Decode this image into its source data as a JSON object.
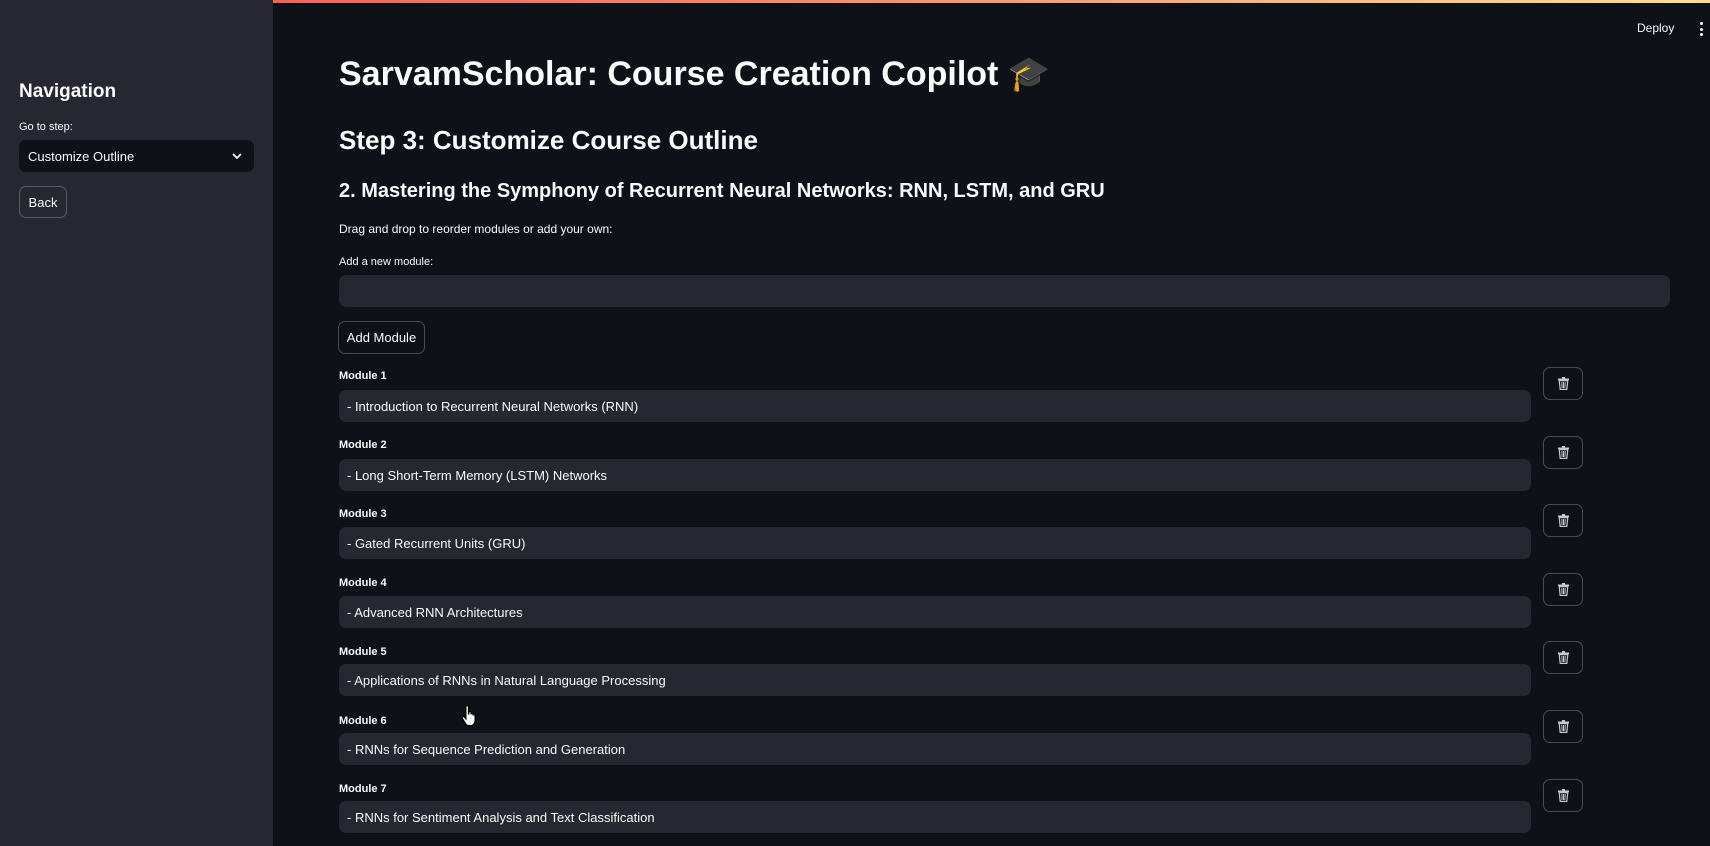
{
  "sidebar": {
    "heading": "Navigation",
    "step_label": "Go to step:",
    "step_value": "Customize Outline",
    "back_label": "Back"
  },
  "header": {
    "deploy_label": "Deploy"
  },
  "main": {
    "title": "SarvamScholar: Course Creation Copilot",
    "title_emoji": "🎓",
    "step_title": "Step 3: Customize Course Outline",
    "course_title": "2. Mastering the Symphony of Recurrent Neural Networks: RNN, LSTM, and GRU",
    "instructions": "Drag and drop to reorder modules or add your own:",
    "add_label": "Add a new module:",
    "add_value": "",
    "add_button": "Add Module",
    "modules": [
      {
        "label": "Module 1",
        "value": "- Introduction to Recurrent Neural Networks (RNN)"
      },
      {
        "label": "Module 2",
        "value": "- Long Short-Term Memory (LSTM) Networks"
      },
      {
        "label": "Module 3",
        "value": "- Gated Recurrent Units (GRU)"
      },
      {
        "label": "Module 4",
        "value": "- Advanced RNN Architectures"
      },
      {
        "label": "Module 5",
        "value": "- Applications of RNNs in Natural Language Processing"
      },
      {
        "label": "Module 6",
        "value": "- RNNs for Sequence Prediction and Generation"
      },
      {
        "label": "Module 7",
        "value": "- RNNs for Sentiment Analysis and Text Classification"
      }
    ]
  }
}
